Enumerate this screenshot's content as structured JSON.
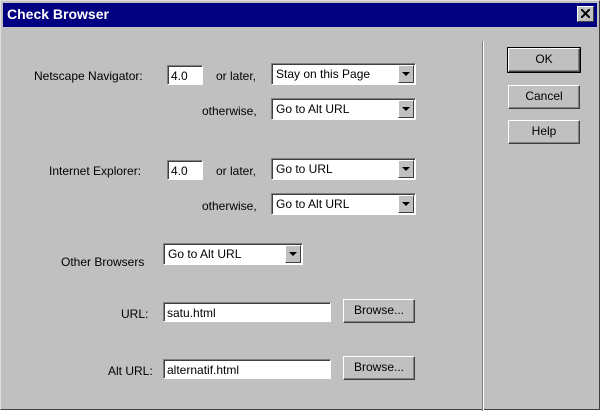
{
  "window": {
    "title": "Check Browser"
  },
  "netscape": {
    "label": "Netscape Navigator:",
    "version": "4.0",
    "or_later_label": "or later,",
    "or_later_value": "Stay on this Page",
    "otherwise_label": "otherwise,",
    "otherwise_value": "Go to Alt URL"
  },
  "ie": {
    "label": "Internet Explorer:",
    "version": "4.0",
    "or_later_label": "or later,",
    "or_later_value": "Go to URL",
    "otherwise_label": "otherwise,",
    "otherwise_value": "Go to Alt URL"
  },
  "other": {
    "label": "Other Browsers",
    "value": "Go to Alt URL"
  },
  "url": {
    "label": "URL:",
    "value": "satu.html",
    "browse_label": "Browse..."
  },
  "alt_url": {
    "label": "Alt URL:",
    "value": "alternatif.html",
    "browse_label": "Browse..."
  },
  "buttons": {
    "ok": "OK",
    "cancel": "Cancel",
    "help": "Help"
  },
  "colors": {
    "title_bar": "#000080",
    "dialog_face": "#c0c0c0"
  },
  "icons": {
    "close": "close-icon",
    "dropdown": "chevron-down-icon"
  }
}
